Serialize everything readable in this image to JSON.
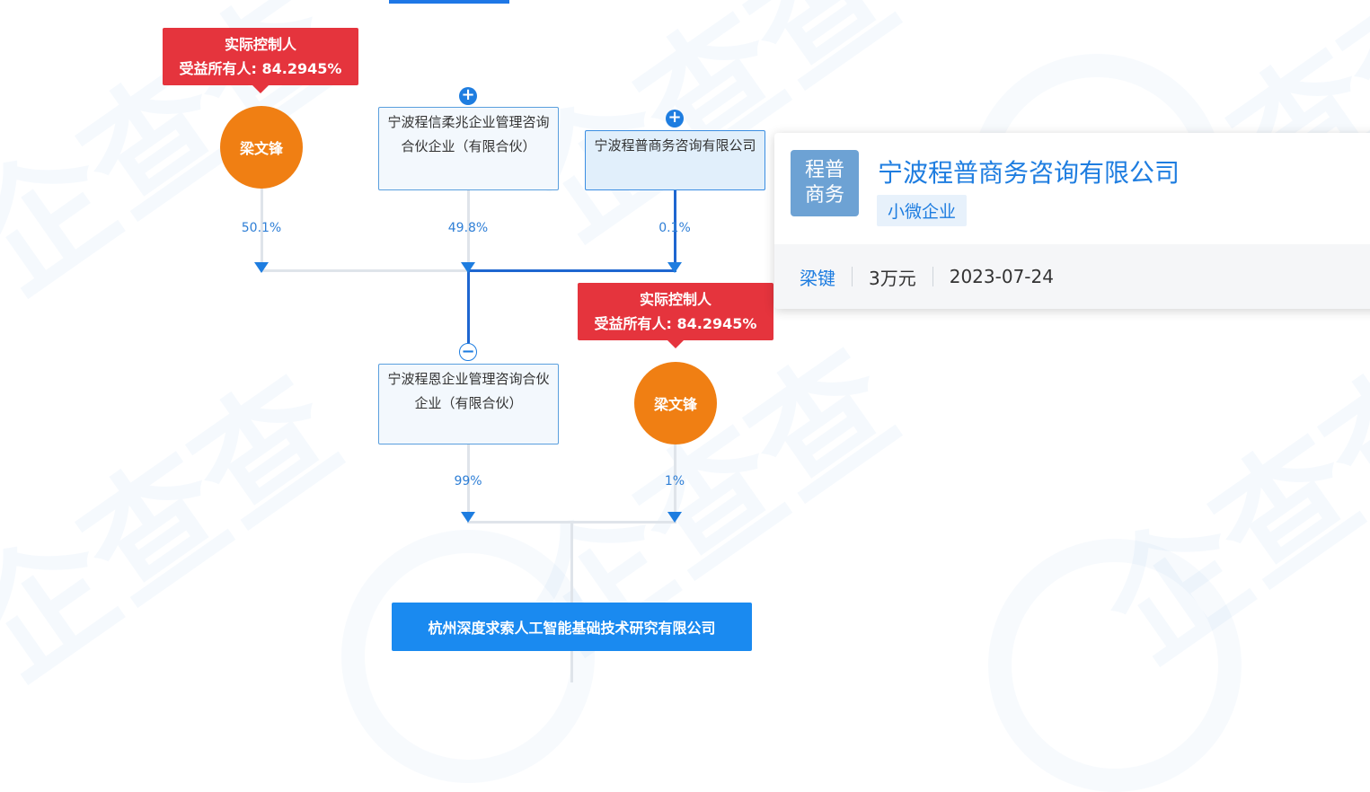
{
  "controller_tag": {
    "line1": "实际控制人",
    "line2": "受益所有人: 84.2945%"
  },
  "persons": {
    "top": "梁文锋",
    "mid": "梁文锋"
  },
  "companies": {
    "xinrou": "宁波程信柔兆企业管理咨询合伙企业（有限合伙）",
    "chengpu": "宁波程普商务咨询有限公司",
    "chengen": "宁波程恩企业管理咨询合伙企业（有限合伙）",
    "target": "杭州深度求索人工智能基础技术研究有限公司"
  },
  "percents": {
    "p_top_person": "50.1%",
    "p_xinrou": "49.8%",
    "p_chengpu": "0.1%",
    "p_chengen": "99%",
    "p_mid_person": "1%"
  },
  "card": {
    "logo_text": "程普商务",
    "title": "宁波程普商务咨询有限公司",
    "tag": "小微企业",
    "legal_rep": "梁键",
    "capital": "3万元",
    "date": "2023-07-24"
  },
  "colors": {
    "accent": "#1e7de0",
    "controller": "#e5343d",
    "person": "#f07f13"
  }
}
